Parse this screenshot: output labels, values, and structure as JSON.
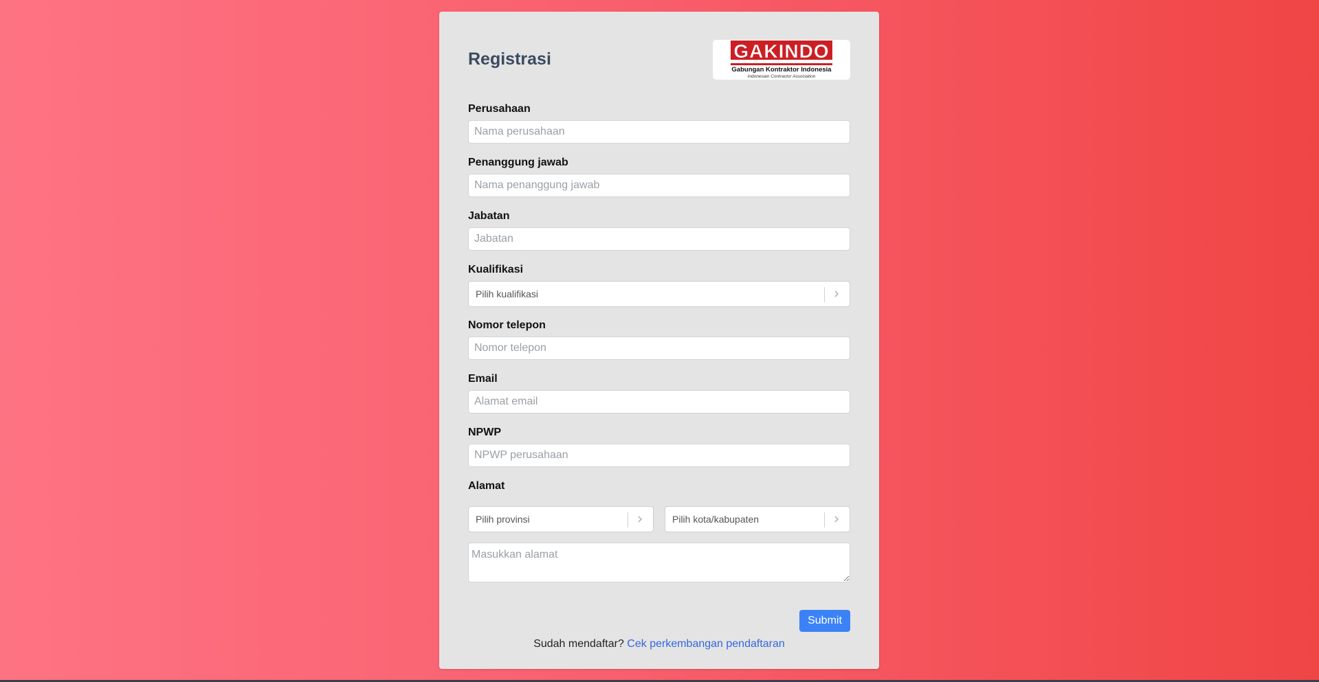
{
  "form": {
    "title": "Registrasi",
    "logo": {
      "name": "GAKINDO",
      "subtitle": "Gabungan Kontraktor Indonesia",
      "tagline": "Indonesian Contractor Association"
    },
    "fields": {
      "perusahaan": {
        "label": "Perusahaan",
        "placeholder": "Nama perusahaan"
      },
      "penanggung": {
        "label": "Penanggung jawab",
        "placeholder": "Nama penanggung jawab"
      },
      "jabatan": {
        "label": "Jabatan",
        "placeholder": "Jabatan"
      },
      "kualifikasi": {
        "label": "Kualifikasi",
        "placeholder": "Pilih kualifikasi"
      },
      "telepon": {
        "label": "Nomor telepon",
        "placeholder": "Nomor telepon"
      },
      "email": {
        "label": "Email",
        "placeholder": "Alamat email"
      },
      "npwp": {
        "label": "NPWP",
        "placeholder": "NPWP perusahaan"
      },
      "alamat": {
        "label": "Alamat",
        "provinsi_placeholder": "Pilih provinsi",
        "kota_placeholder": "Pilih kota/kabupaten",
        "address_placeholder": "Masukkan alamat"
      }
    },
    "submit_label": "Submit",
    "footer": {
      "text": "Sudah mendaftar?",
      "link_text": "Cek perkembangan pendaftaran"
    }
  },
  "colors": {
    "background_start": "#fe7383",
    "background_end": "#f04545",
    "card": "#e4e4e4",
    "title": "#3b4a60",
    "primary_button": "#3b82f6",
    "link": "#3366dd",
    "logo_red": "#cc1f24"
  },
  "icons": {
    "select_indicator": "chevron-right-icon"
  }
}
